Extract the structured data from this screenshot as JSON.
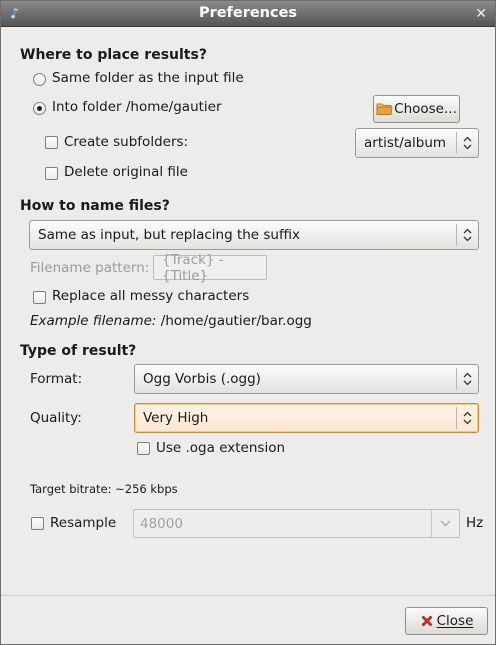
{
  "window": {
    "title": "Preferences"
  },
  "placement": {
    "heading": "Where to place results?",
    "same_folder_label": "Same folder as the input file",
    "into_folder_label": "Into folder /home/gautier",
    "choose_label": "Choose...",
    "create_subfolders_label": "Create subfolders:",
    "subfolder_pattern": "artist/album",
    "delete_original_label": "Delete original file"
  },
  "naming": {
    "heading": "How to name files?",
    "mode_selected": "Same as input, but replacing the suffix",
    "filename_pattern_label": "Filename pattern:",
    "filename_pattern_value": "{Track} - {Title}",
    "replace_messy_label": "Replace all messy characters",
    "example_label": "Example filename:",
    "example_value": "/home/gautier/bar.ogg"
  },
  "result": {
    "heading": "Type of result?",
    "format_label": "Format:",
    "format_value": "Ogg Vorbis (.ogg)",
    "quality_label": "Quality:",
    "quality_value": "Very High",
    "oga_label": "Use .oga extension",
    "bitrate_text": "Target bitrate: ~256 kbps",
    "resample_label": "Resample",
    "resample_value": "48000",
    "resample_unit": "Hz"
  },
  "footer": {
    "close_label": "Close"
  },
  "colors": {
    "titlebar": "#6e6e6e",
    "focus": "#d08a3c",
    "close_icon": "#d0342c",
    "folder_icon": "#e8a23a"
  }
}
